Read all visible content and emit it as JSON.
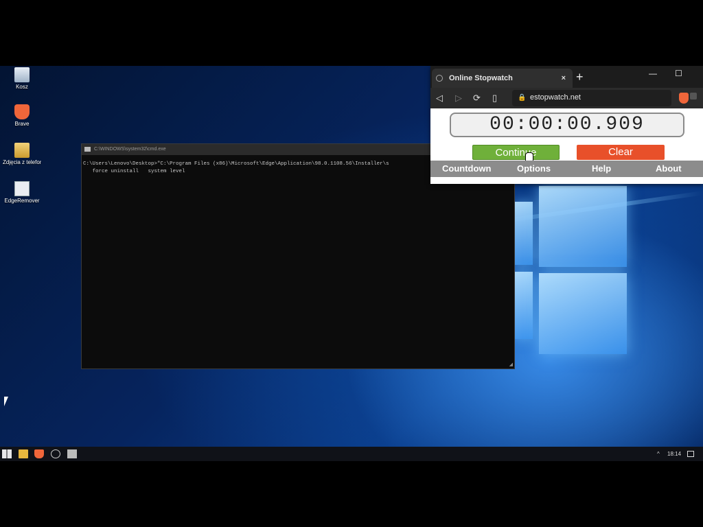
{
  "desktop": {
    "icons": [
      {
        "label": "Kosz",
        "icon": "recycle-bin-icon"
      },
      {
        "label": "Brave",
        "icon": "brave-icon"
      },
      {
        "label": "Zdjęcia z telefonu",
        "icon": "folder-photos-icon"
      },
      {
        "label": "EdgeRemover",
        "icon": "app-icon"
      }
    ]
  },
  "console": {
    "title": "C:\\WINDOWS\\system32\\cmd.exe",
    "line1": "C:\\Users\\Lenovo\\Desktop>\"C:\\Program Files (x86)\\Microsoft\\Edge\\Application\\98.0.1108.56\\Installer\\s",
    "line2": "   force uninstall   system level"
  },
  "browser": {
    "tab_title": "Online Stopwatch",
    "tab_close": "×",
    "new_tab": "+",
    "url": "estopwatch.net",
    "nav": {
      "back": "◁",
      "forward": "▷",
      "reload": "⟳",
      "bookmark": "▯"
    },
    "window_controls": {
      "minimize": "—",
      "maximize": "☐"
    }
  },
  "stopwatch": {
    "time": "00:00:00.909",
    "continue_label": "Continue",
    "clear_label": "Clear",
    "menu": [
      "Countdown",
      "Options",
      "Help",
      "About"
    ],
    "colors": {
      "continue": "#6fb03a",
      "clear": "#e8502a",
      "menubar": "#8c8c8c"
    }
  },
  "taskbar": {
    "clock": "18:14",
    "tray_chevron": "^"
  }
}
